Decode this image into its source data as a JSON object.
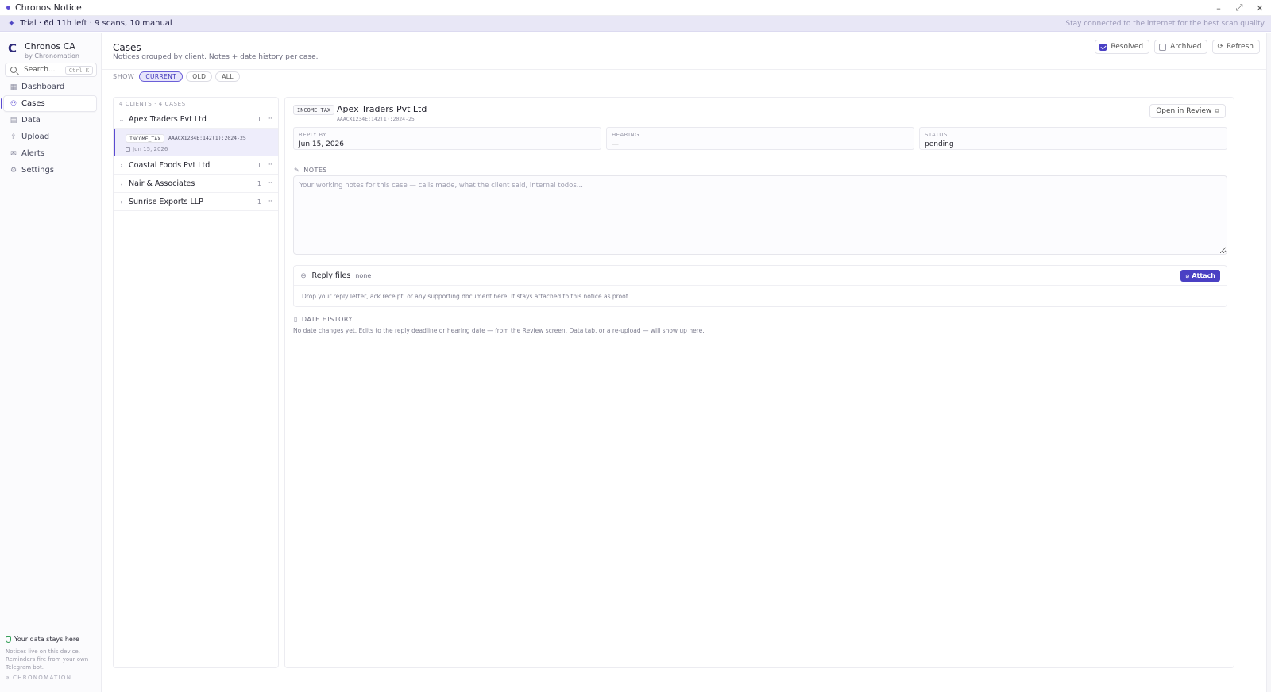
{
  "window": {
    "title": "Chronos Notice",
    "controls": {
      "minimize": "–",
      "maximize": "⤢",
      "close": "✕"
    }
  },
  "banner": {
    "trial": "Trial · 6d 11h left · 9 scans, 10 manual",
    "tip": "Stay connected to the internet for the best scan quality"
  },
  "sidebar": {
    "brand_name": "Chronos CA",
    "brand_sub": "by Chronomation",
    "search_label": "Search...",
    "search_shortcut": "Ctrl K",
    "items": [
      {
        "label": "Dashboard",
        "icon": "dashboard-icon",
        "glyph": "▦"
      },
      {
        "label": "Cases",
        "icon": "users-icon",
        "glyph": "⚇"
      },
      {
        "label": "Data",
        "icon": "table-icon",
        "glyph": "▤"
      },
      {
        "label": "Upload",
        "icon": "upload-icon",
        "glyph": "⇪"
      },
      {
        "label": "Alerts",
        "icon": "mail-icon",
        "glyph": "✉"
      },
      {
        "label": "Settings",
        "icon": "gear-icon",
        "glyph": "⚙"
      }
    ],
    "active_item": "Cases",
    "data_note": {
      "title": "Your data stays here",
      "text": "Notices live on this device. Reminders fire from your own Telegram bot.",
      "brand": "⌀ CHRONOMATION"
    }
  },
  "header": {
    "title": "Cases",
    "subtitle": "Notices grouped by client. Notes + date history per case.",
    "resolved_label": "Resolved",
    "resolved_checked": true,
    "archived_label": "Archived",
    "archived_checked": false,
    "refresh_label": "Refresh"
  },
  "filter": {
    "label": "SHOW",
    "options": [
      "CURRENT",
      "OLD",
      "ALL"
    ],
    "selected": "CURRENT"
  },
  "clients": {
    "summary": "4 CLIENTS · 4 CASES",
    "list": [
      {
        "name": "Apex Traders Pvt Ltd",
        "count": "1",
        "expanded": true
      },
      {
        "name": "Coastal Foods Pvt Ltd",
        "count": "1",
        "expanded": false
      },
      {
        "name": "Nair & Associates",
        "count": "1",
        "expanded": false
      },
      {
        "name": "Sunrise Exports LLP",
        "count": "1",
        "expanded": false
      }
    ],
    "selected_case": {
      "tag": "INCOME_TAX",
      "ref": "AAACX1234E:142(1):2024-25",
      "date": "Jun 15, 2026"
    }
  },
  "detail": {
    "tag": "INCOME_TAX",
    "title": "Apex Traders Pvt Ltd",
    "ref": "AAACX1234E:142(1):2024-25",
    "open_review_label": "Open in Review",
    "facts": [
      {
        "label": "REPLY BY",
        "value": "Jun 15, 2026"
      },
      {
        "label": "HEARING",
        "value": "—"
      },
      {
        "label": "STATUS",
        "value": "pending"
      }
    ],
    "notes_label": "NOTES",
    "notes_placeholder": "Your working notes for this case — calls made, what the client said, internal todos...",
    "notes_value": "",
    "reply_files_title": "Reply files",
    "reply_files_status": "none",
    "attach_label": "Attach",
    "reply_hint": "Drop your reply letter, ack receipt, or any supporting document here. It stays attached to this notice as proof.",
    "date_history_label": "DATE HISTORY",
    "date_history_text": "No date changes yet. Edits to the reply deadline or hearing date — from the Review screen, Data tab, or a re-upload — will show up here."
  },
  "colors": {
    "accent": "#4a40c4",
    "accent_soft": "#e7e5fb",
    "banner_bg": "#e8e7f6",
    "safe_green": "#37a05a"
  }
}
